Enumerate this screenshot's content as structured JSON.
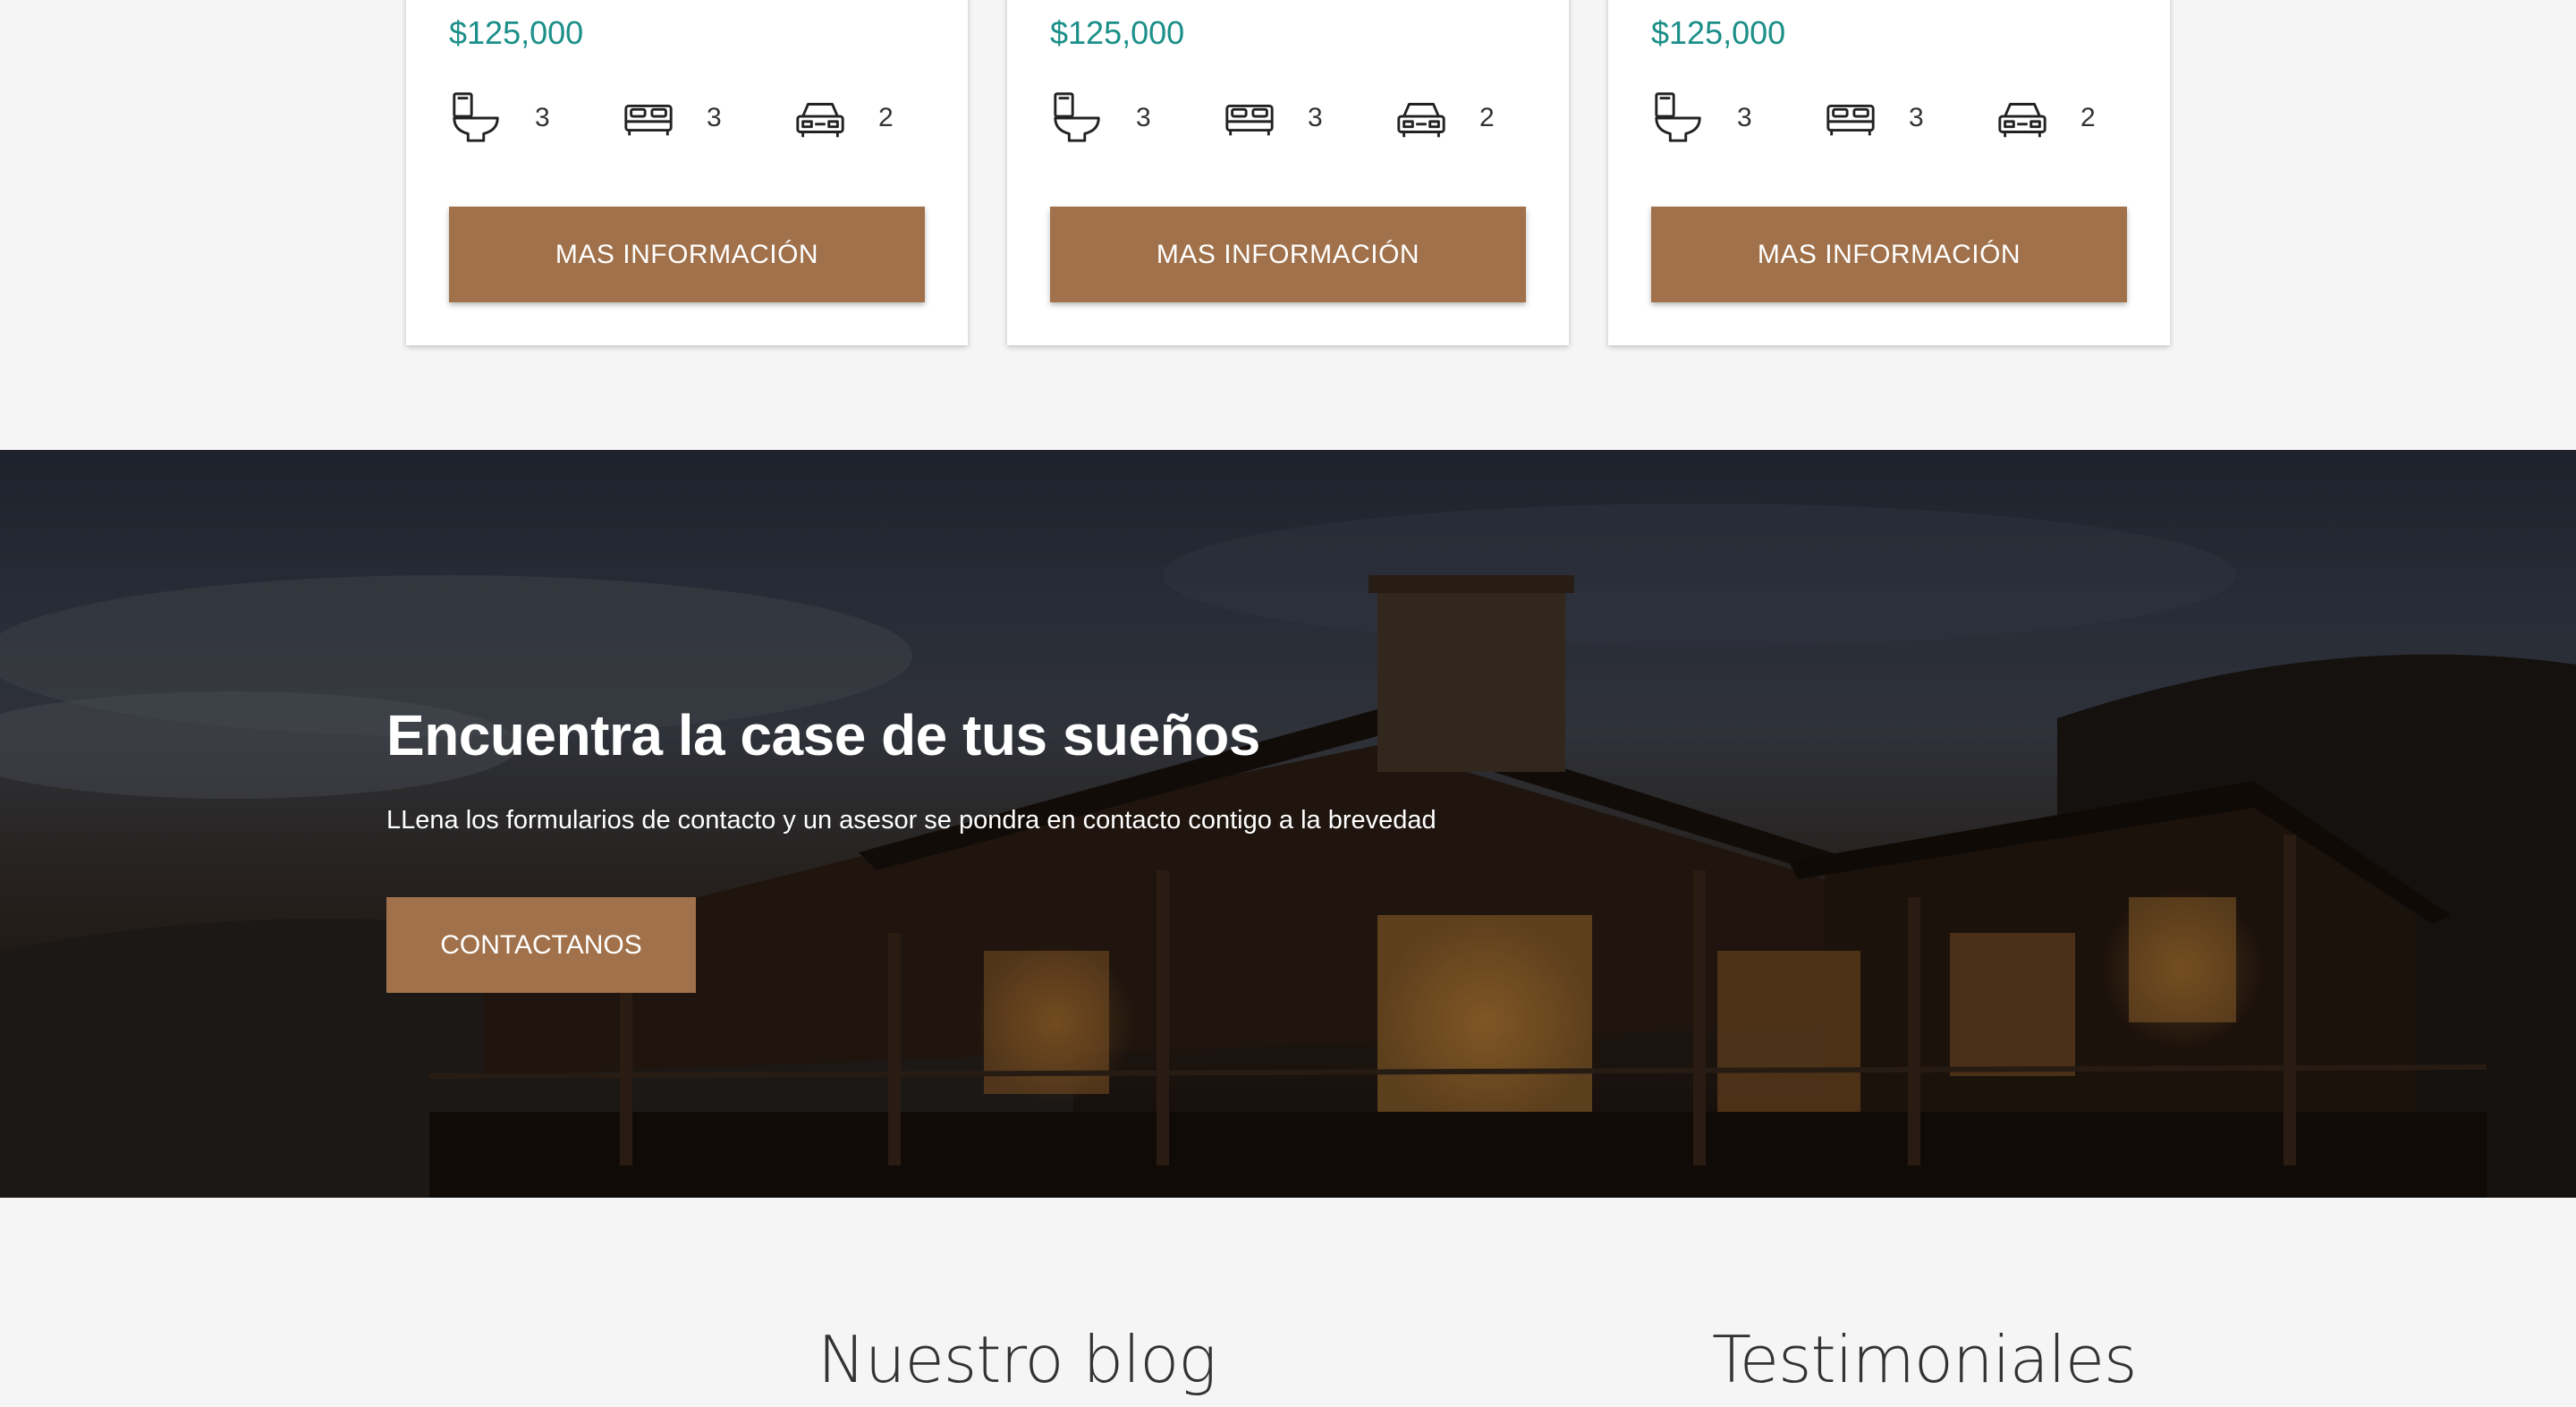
{
  "listings": [
    {
      "price": "$125,000",
      "features": [
        {
          "icon": "toilet-icon",
          "value": "3"
        },
        {
          "icon": "bed-icon",
          "value": "3"
        },
        {
          "icon": "car-icon",
          "value": "2"
        }
      ],
      "button_label": "MAS INFORMACIÓN"
    },
    {
      "price": "$125,000",
      "features": [
        {
          "icon": "toilet-icon",
          "value": "3"
        },
        {
          "icon": "bed-icon",
          "value": "3"
        },
        {
          "icon": "car-icon",
          "value": "2"
        }
      ],
      "button_label": "MAS INFORMACIÓN"
    },
    {
      "price": "$125,000",
      "features": [
        {
          "icon": "toilet-icon",
          "value": "3"
        },
        {
          "icon": "bed-icon",
          "value": "3"
        },
        {
          "icon": "car-icon",
          "value": "2"
        }
      ],
      "button_label": "MAS INFORMACIÓN"
    }
  ],
  "hero": {
    "title": "Encuentra la case de tus sueños",
    "subtitle": "LLena los formularios de contacto y un asesor se pondra en contacto contigo a la brevedad",
    "button_label": "CONTACTANOS"
  },
  "sections": {
    "blog_title": "Nuestro blog",
    "testimonials_title": "Testimoniales"
  },
  "colors": {
    "accent": "#a0714a",
    "price": "#1b8f88",
    "background": "#f5f5f5"
  }
}
